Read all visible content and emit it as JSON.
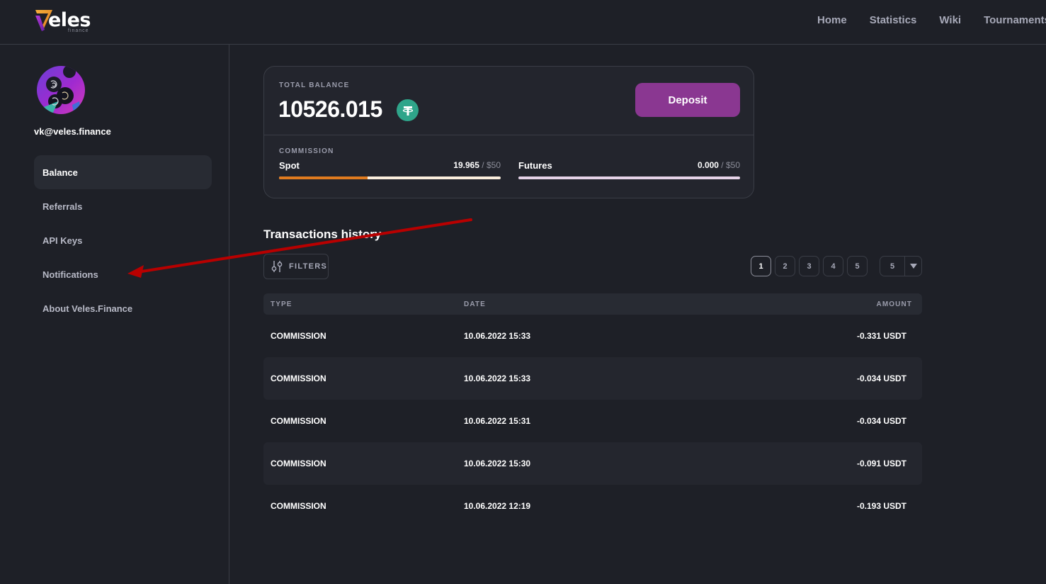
{
  "header": {
    "logo_text": "eles",
    "logo_sub": "finance",
    "nav": [
      "Home",
      "Statistics",
      "Wiki",
      "Tournaments"
    ]
  },
  "sidebar": {
    "email": "vk@veles.finance",
    "items": [
      {
        "label": "Balance",
        "active": true
      },
      {
        "label": "Referrals",
        "active": false
      },
      {
        "label": "API Keys",
        "active": false
      },
      {
        "label": "Notifications",
        "active": false
      },
      {
        "label": "About Veles.Finance",
        "active": false
      }
    ]
  },
  "balance": {
    "label": "TOTAL BALANCE",
    "value": "10526.015",
    "currency_icon": "tether-icon",
    "deposit_label": "Deposit",
    "commission_label": "COMMISSION",
    "spot": {
      "name": "Spot",
      "value": "19.965",
      "max": " / $50",
      "fraction": 0.3993,
      "fill_color": "#e07b1f",
      "track_color": "#fbeedd"
    },
    "futures": {
      "name": "Futures",
      "value": "0.000",
      "max": " / $50",
      "fraction": 0.0,
      "fill_color": "#e07b1f",
      "track_color": "#e6d3e8"
    }
  },
  "transactions": {
    "title": "Transactions history",
    "filters_label": "FILTERS",
    "pages": [
      "1",
      "2",
      "3",
      "4",
      "5"
    ],
    "current_page": "1",
    "per_page": "5",
    "columns": [
      "TYPE",
      "DATE",
      "AMOUNT"
    ],
    "rows": [
      {
        "type": "COMMISSION",
        "date": "10.06.2022 15:33",
        "amount": "-0.331 USDT"
      },
      {
        "type": "COMMISSION",
        "date": "10.06.2022 15:33",
        "amount": "-0.034 USDT"
      },
      {
        "type": "COMMISSION",
        "date": "10.06.2022 15:31",
        "amount": "-0.034 USDT"
      },
      {
        "type": "COMMISSION",
        "date": "10.06.2022 15:30",
        "amount": "-0.091 USDT"
      },
      {
        "type": "COMMISSION",
        "date": "10.06.2022 12:19",
        "amount": "-0.193 USDT"
      }
    ]
  },
  "annotation": {
    "color": "#c00000",
    "points_to": "Notifications"
  }
}
